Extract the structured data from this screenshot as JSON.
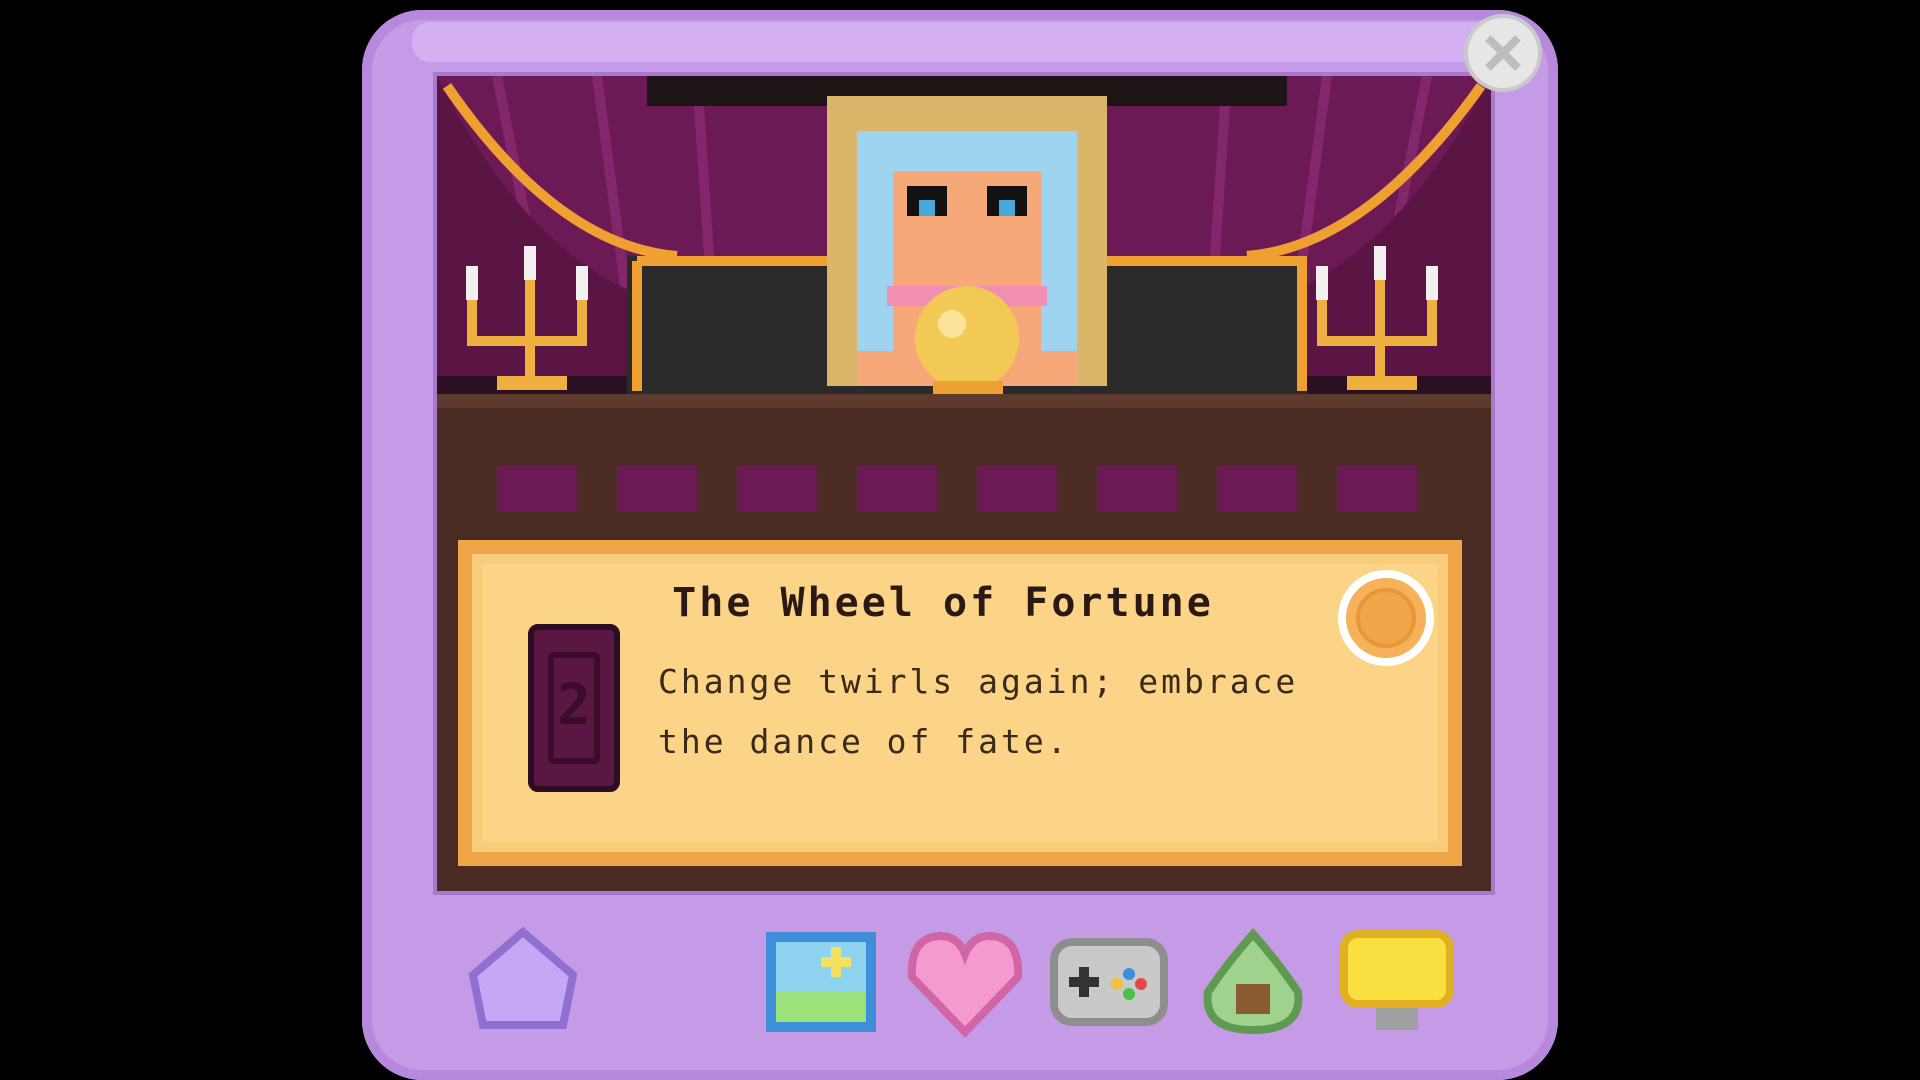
{
  "card": {
    "title": "The Wheel of Fortune",
    "description": "Change twirls again; embrace the dance of fate.",
    "number": "2"
  },
  "toolbar": {
    "items": [
      {
        "icon": "home-icon"
      },
      {
        "icon": "gallery-icon"
      },
      {
        "icon": "heart-icon"
      },
      {
        "icon": "gamepad-icon"
      },
      {
        "icon": "avocado-icon"
      },
      {
        "icon": "lightbulb-icon"
      }
    ]
  },
  "colors": {
    "device": "#c59be8",
    "curtain": "#6b1a55",
    "parchment": "#f8cd7a",
    "gold": "#f0a648"
  }
}
